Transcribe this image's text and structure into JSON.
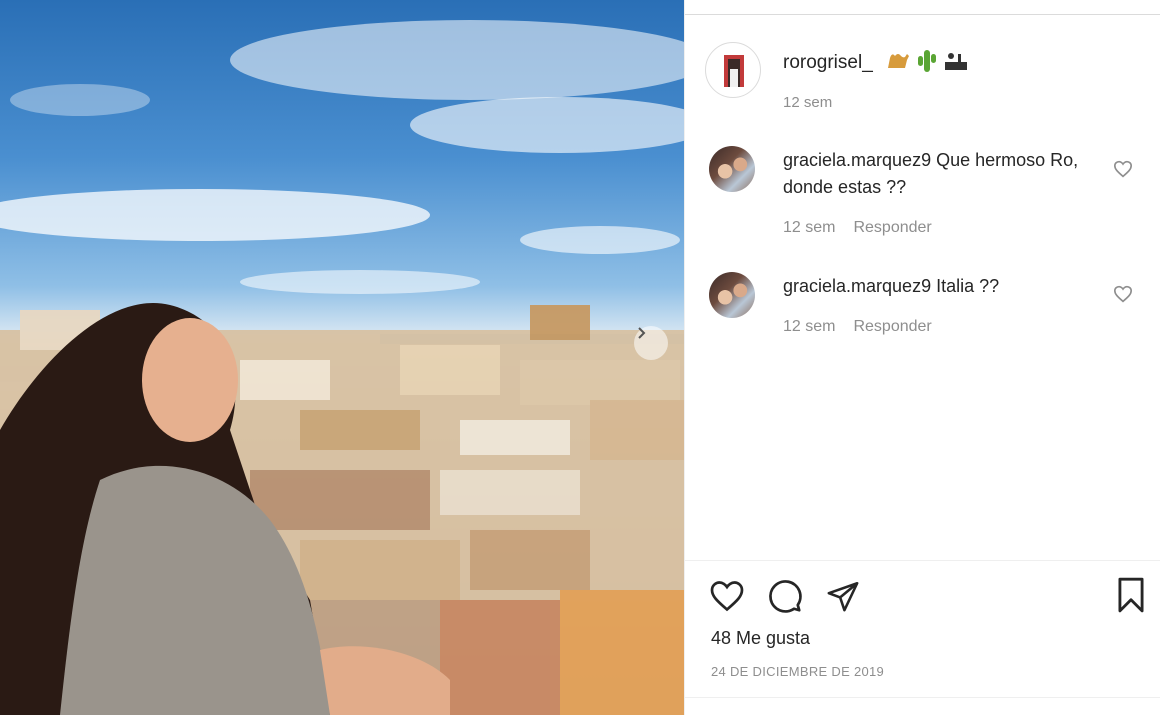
{
  "post": {
    "author": "rorogrisel_",
    "author_emoji": [
      "camel-emoji",
      "cactus-emoji",
      "desert-emoji"
    ],
    "time": "12 sem",
    "likes": "48 Me gusta",
    "date": "24 DE DICIEMBRE DE 2019"
  },
  "comments": [
    {
      "user": "graciela.marquez9",
      "text": "Que hermoso Ro, donde estas ??",
      "time": "12 sem",
      "reply": "Responder"
    },
    {
      "user": "graciela.marquez9",
      "text": "Italia ??",
      "time": "12 sem",
      "reply": "Responder"
    }
  ],
  "colors": {
    "text": "#262626",
    "secondary": "#8e8e8e",
    "divider": "#dbdbdb"
  }
}
